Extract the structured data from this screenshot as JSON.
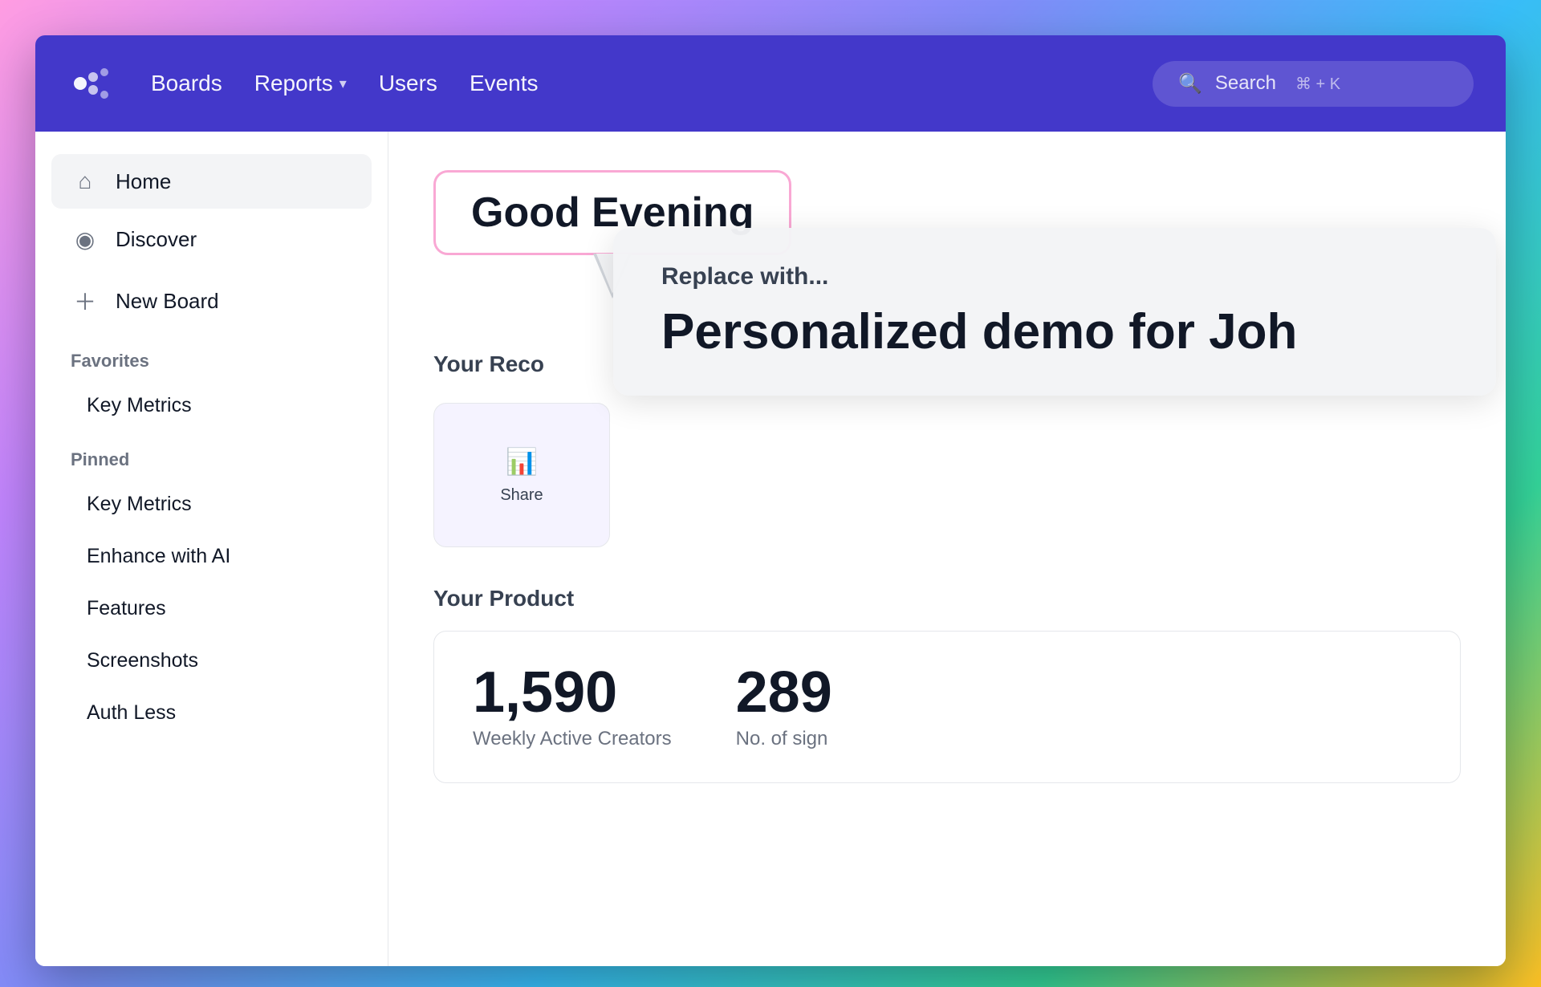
{
  "app": {
    "title": "Mixpanel"
  },
  "topbar": {
    "nav_boards": "Boards",
    "nav_reports": "Reports",
    "nav_users": "Users",
    "nav_events": "Events",
    "search_placeholder": "Search",
    "search_shortcut": "⌘ + K"
  },
  "sidebar": {
    "home_label": "Home",
    "discover_label": "Discover",
    "new_board_label": "New Board",
    "favorites_label": "Favorites",
    "favorites_items": [
      {
        "label": "Key Metrics"
      }
    ],
    "pinned_label": "Pinned",
    "pinned_items": [
      {
        "label": "Key Metrics"
      },
      {
        "label": "Enhance with AI"
      },
      {
        "label": "Features"
      },
      {
        "label": "Screenshots"
      },
      {
        "label": "Auth Less"
      }
    ]
  },
  "main": {
    "greeting": "Good Evening",
    "recent_section": "Your Reco",
    "product_section": "Your Product",
    "tooltip_replace": "Replace with...",
    "tooltip_main": "Personalized demo for Joh",
    "board_card_label": "Share",
    "metric1_value": "1,590",
    "metric1_label": "Weekly Active Creators",
    "metric2_value": "289",
    "metric2_label": "No. of sign"
  }
}
